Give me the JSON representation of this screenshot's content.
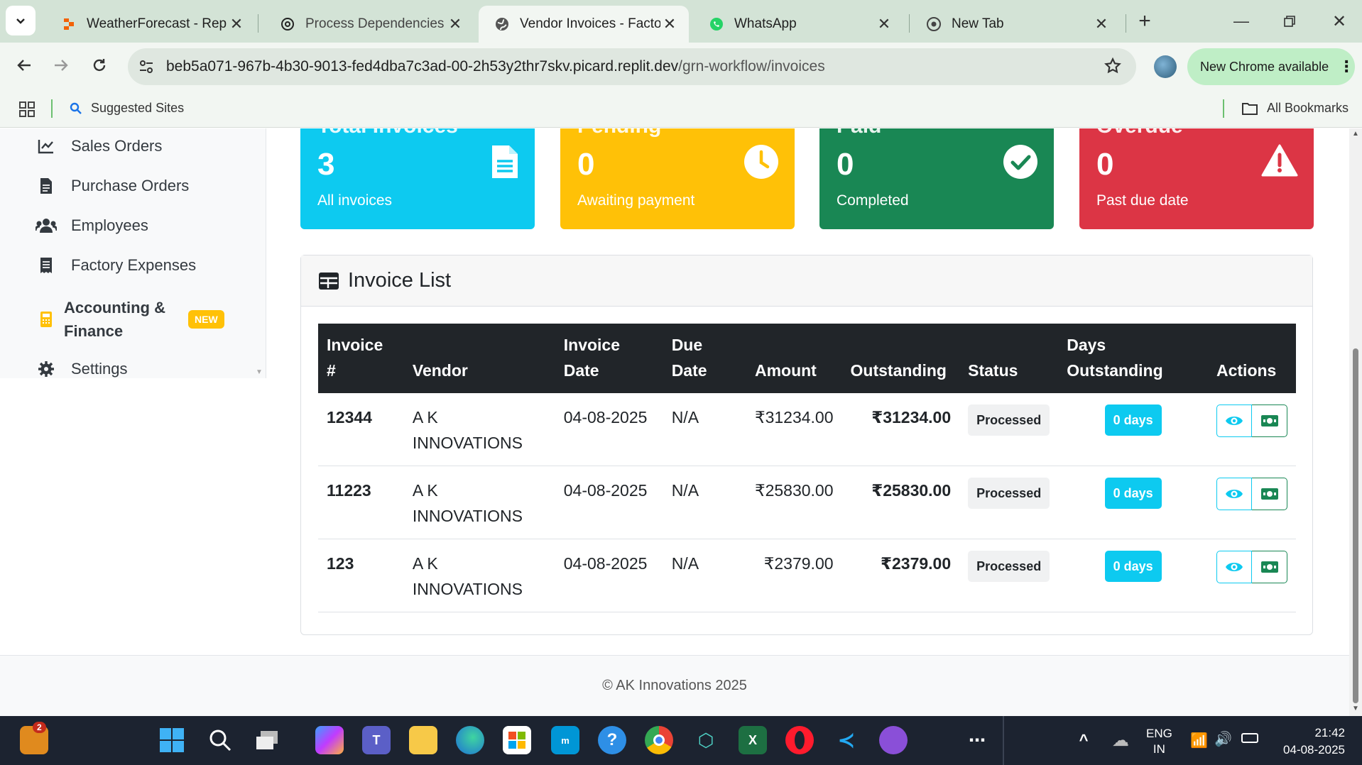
{
  "browser": {
    "tabs": [
      {
        "title": "WeatherForecast - Replit",
        "icon": "replit-icon",
        "active": false
      },
      {
        "title": "Process Dependencies O",
        "icon": "chatgpt-icon",
        "active": false
      },
      {
        "title": "Vendor Invoices - Factory",
        "icon": "globe-icon",
        "active": true
      },
      {
        "title": "WhatsApp",
        "icon": "whatsapp-icon",
        "active": false
      },
      {
        "title": "New Tab",
        "icon": "chrome-icon",
        "active": false
      }
    ],
    "url_host": "beb5a071-967b-4b30-9013-fed4dba7c3ad-00-2h53y2thr7skv.picard.replit.dev",
    "url_path": "/grn-workflow/invoices",
    "new_chrome_label": "New Chrome available",
    "bookmarks": {
      "suggested": "Suggested Sites",
      "all": "All Bookmarks"
    }
  },
  "sidebar": {
    "items": [
      {
        "label": "Sales Orders",
        "icon": "chart-line-icon"
      },
      {
        "label": "Purchase Orders",
        "icon": "file-invoice-icon"
      },
      {
        "label": "Employees",
        "icon": "users-icon"
      },
      {
        "label": "Factory Expenses",
        "icon": "receipt-icon"
      },
      {
        "label": "Accounting &",
        "label2": "Finance",
        "icon": "calculator-icon",
        "badge": "NEW"
      },
      {
        "label": "Settings",
        "icon": "gear-icon"
      }
    ]
  },
  "cards": [
    {
      "title": "Total Invoices",
      "value": "3",
      "sub": "All invoices",
      "color": "#0dcaf0",
      "icon": "document-icon"
    },
    {
      "title": "Pending",
      "value": "0",
      "sub": "Awaiting payment",
      "color": "#ffc107",
      "icon": "clock-icon"
    },
    {
      "title": "Paid",
      "value": "0",
      "sub": "Completed",
      "color": "#198754",
      "icon": "check-circle-icon"
    },
    {
      "title": "Overdue",
      "value": "0",
      "sub": "Past due date",
      "color": "#dc3545",
      "icon": "warning-icon"
    }
  ],
  "invoice_list": {
    "title": "Invoice List",
    "columns": {
      "invoice": "Invoice",
      "invoice2": "#",
      "vendor": "Vendor",
      "date": "Invoice",
      "date2": "Date",
      "due": "Due",
      "due2": "Date",
      "amount": "Amount",
      "outstanding": "Outstanding",
      "status": "Status",
      "days": "Days",
      "days2": "Outstanding",
      "actions": "Actions"
    },
    "rows": [
      {
        "invoice": "12344",
        "vendor": "A K",
        "vendor2": "INNOVATIONS",
        "date": "04-08-2025",
        "due": "N/A",
        "amount": "₹31234.00",
        "outstanding": "₹31234.00",
        "status": "Processed",
        "days": "0 days"
      },
      {
        "invoice": "11223",
        "vendor": "A K",
        "vendor2": "INNOVATIONS",
        "date": "04-08-2025",
        "due": "N/A",
        "amount": "₹25830.00",
        "outstanding": "₹25830.00",
        "status": "Processed",
        "days": "0 days"
      },
      {
        "invoice": "123",
        "vendor": "A K",
        "vendor2": "INNOVATIONS",
        "date": "04-08-2025",
        "due": "N/A",
        "amount": "₹2379.00",
        "outstanding": "₹2379.00",
        "status": "Processed",
        "days": "0 days"
      }
    ]
  },
  "footer": "© AK Innovations 2025",
  "taskbar": {
    "lang1": "ENG",
    "lang2": "IN",
    "time": "21:42",
    "date": "04-08-2025",
    "notif_count": "2"
  }
}
